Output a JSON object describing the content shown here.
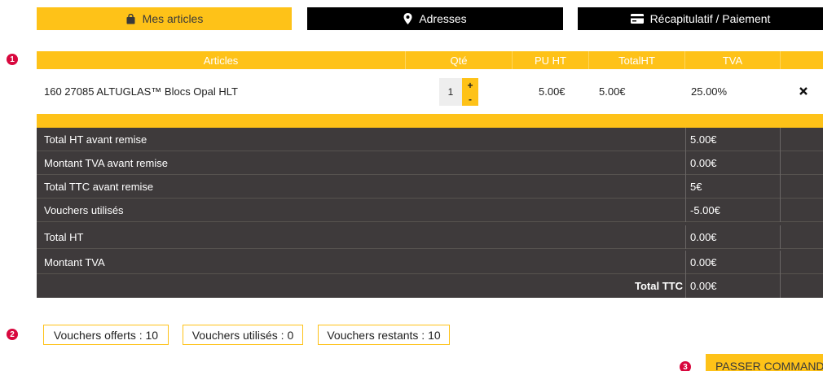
{
  "steps": [
    {
      "label": "Mes articles",
      "icon": "shopping-bag-icon"
    },
    {
      "label": "Adresses",
      "icon": "map-pin-icon"
    },
    {
      "label": "Récapitulatif / Paiement",
      "icon": "credit-card-icon"
    }
  ],
  "markers": [
    "1",
    "2",
    "3"
  ],
  "table": {
    "headers": [
      "Articles",
      "Qté",
      "PU HT",
      "TotalHT",
      "TVA",
      ""
    ],
    "item": {
      "name": "160 27085 ALTUGLAS™ Blocs Opal HLT",
      "qty": "1",
      "plus": "+",
      "minus": "-",
      "pu_ht": "5.00€",
      "total_ht": "5.00€",
      "tva": "25.00%",
      "remove": "✕"
    }
  },
  "totals": [
    {
      "label": "Total HT avant remise",
      "value": "5.00€"
    },
    {
      "label": "Montant TVA avant remise",
      "value": "0.00€"
    },
    {
      "label": "Total TTC avant remise",
      "value": "5€"
    },
    {
      "label": "Vouchers utilisés",
      "value": "-5.00€"
    },
    {
      "label": "Total HT",
      "value": "0.00€"
    },
    {
      "label": "Montant TVA",
      "value": "0.00€"
    },
    {
      "label": "Total TTC",
      "value": "0.00€"
    }
  ],
  "vouchers": {
    "offered": "Vouchers offerts : 10",
    "used": "Vouchers utilisés : 0",
    "remaining": "Vouchers restants : 10"
  },
  "order_button": "PASSER COMMANDE",
  "colors": {
    "accent": "#fec218",
    "dark": "#3e3a3b",
    "marker": "#d8083e"
  }
}
